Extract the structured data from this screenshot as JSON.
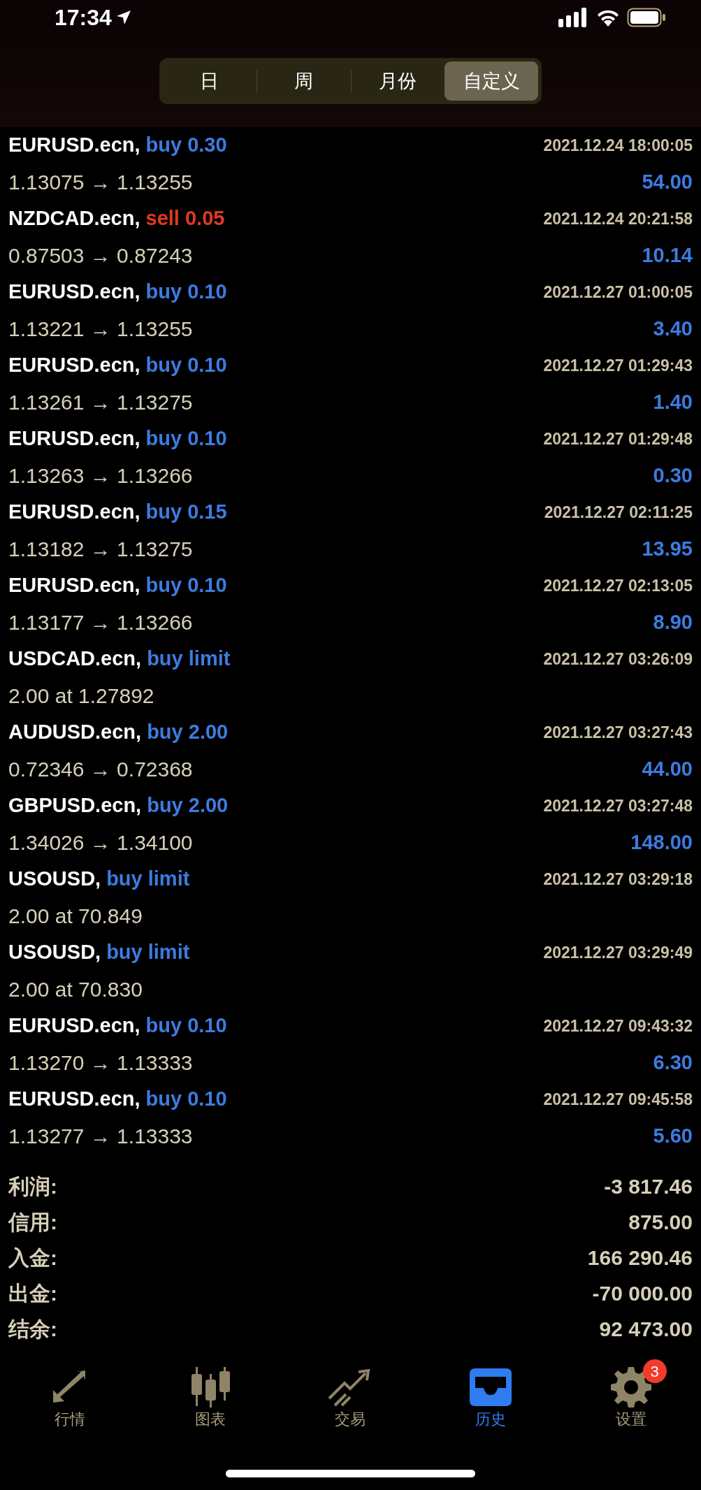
{
  "status_bar": {
    "time": "17:34"
  },
  "tabs": [
    {
      "label": "日",
      "selected": false
    },
    {
      "label": "周",
      "selected": false
    },
    {
      "label": "月份",
      "selected": false
    },
    {
      "label": "自定义",
      "selected": true
    }
  ],
  "orders": [
    {
      "symbol": "EURUSD.ecn,",
      "kind": "buy",
      "action": "buy 0.30",
      "time": "2021.12.24 18:00:05",
      "prices": "1.13075 → 1.13255",
      "profit": "54.00"
    },
    {
      "symbol": "NZDCAD.ecn,",
      "kind": "sell",
      "action": "sell 0.05",
      "time": "2021.12.24 20:21:58",
      "prices": "0.87503 → 0.87243",
      "profit": "10.14"
    },
    {
      "symbol": "EURUSD.ecn,",
      "kind": "buy",
      "action": "buy 0.10",
      "time": "2021.12.27 01:00:05",
      "prices": "1.13221 → 1.13255",
      "profit": "3.40"
    },
    {
      "symbol": "EURUSD.ecn,",
      "kind": "buy",
      "action": "buy 0.10",
      "time": "2021.12.27 01:29:43",
      "prices": "1.13261 → 1.13275",
      "profit": "1.40"
    },
    {
      "symbol": "EURUSD.ecn,",
      "kind": "buy",
      "action": "buy 0.10",
      "time": "2021.12.27 01:29:48",
      "prices": "1.13263 → 1.13266",
      "profit": "0.30"
    },
    {
      "symbol": "EURUSD.ecn,",
      "kind": "buy",
      "action": "buy 0.15",
      "time": "2021.12.27 02:11:25",
      "prices": "1.13182 → 1.13275",
      "profit": "13.95"
    },
    {
      "symbol": "EURUSD.ecn,",
      "kind": "buy",
      "action": "buy 0.10",
      "time": "2021.12.27 02:13:05",
      "prices": "1.13177 → 1.13266",
      "profit": "8.90"
    },
    {
      "symbol": "USDCAD.ecn,",
      "kind": "buy",
      "action": "buy limit",
      "time": "2021.12.27 03:26:09",
      "prices": "2.00 at 1.27892"
    },
    {
      "symbol": "AUDUSD.ecn,",
      "kind": "buy",
      "action": "buy 2.00",
      "time": "2021.12.27 03:27:43",
      "prices": "0.72346 → 0.72368",
      "profit": "44.00"
    },
    {
      "symbol": "GBPUSD.ecn,",
      "kind": "buy",
      "action": "buy 2.00",
      "time": "2021.12.27 03:27:48",
      "prices": "1.34026 → 1.34100",
      "profit": "148.00"
    },
    {
      "symbol": "USOUSD,",
      "kind": "buy",
      "action": "buy limit",
      "time": "2021.12.27 03:29:18",
      "prices": "2.00 at 70.849"
    },
    {
      "symbol": "USOUSD,",
      "kind": "buy",
      "action": "buy limit",
      "time": "2021.12.27 03:29:49",
      "prices": "2.00 at 70.830"
    },
    {
      "symbol": "EURUSD.ecn,",
      "kind": "buy",
      "action": "buy 0.10",
      "time": "2021.12.27 09:43:32",
      "prices": "1.13270 → 1.13333",
      "profit": "6.30"
    },
    {
      "symbol": "EURUSD.ecn,",
      "kind": "buy",
      "action": "buy 0.10",
      "time": "2021.12.27 09:45:58",
      "prices": "1.13277 → 1.13333",
      "profit": "5.60"
    }
  ],
  "summary": [
    {
      "label": "利润:",
      "value": "-3 817.46"
    },
    {
      "label": "信用:",
      "value": "875.00"
    },
    {
      "label": "入金:",
      "value": "166 290.46"
    },
    {
      "label": "出金:",
      "value": "-70 000.00"
    },
    {
      "label": "结余:",
      "value": "92 473.00"
    }
  ],
  "nav": [
    {
      "label": "行情",
      "kind": "quotes",
      "selected": false
    },
    {
      "label": "图表",
      "kind": "chart",
      "selected": false
    },
    {
      "label": "交易",
      "kind": "trade",
      "selected": false
    },
    {
      "label": "历史",
      "kind": "history",
      "selected": true
    },
    {
      "label": "设置",
      "kind": "settings",
      "selected": false,
      "badge": "3"
    }
  ]
}
